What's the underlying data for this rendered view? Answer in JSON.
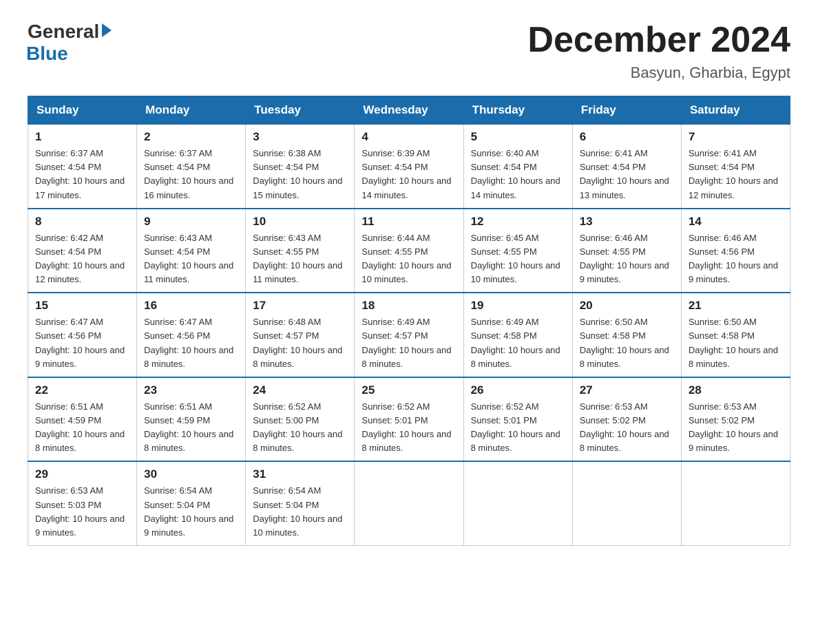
{
  "header": {
    "logo_general": "General",
    "logo_blue": "Blue",
    "month_title": "December 2024",
    "location": "Basyun, Gharbia, Egypt"
  },
  "days_of_week": [
    "Sunday",
    "Monday",
    "Tuesday",
    "Wednesday",
    "Thursday",
    "Friday",
    "Saturday"
  ],
  "weeks": [
    [
      {
        "day": "1",
        "sunrise": "6:37 AM",
        "sunset": "4:54 PM",
        "daylight": "10 hours and 17 minutes."
      },
      {
        "day": "2",
        "sunrise": "6:37 AM",
        "sunset": "4:54 PM",
        "daylight": "10 hours and 16 minutes."
      },
      {
        "day": "3",
        "sunrise": "6:38 AM",
        "sunset": "4:54 PM",
        "daylight": "10 hours and 15 minutes."
      },
      {
        "day": "4",
        "sunrise": "6:39 AM",
        "sunset": "4:54 PM",
        "daylight": "10 hours and 14 minutes."
      },
      {
        "day": "5",
        "sunrise": "6:40 AM",
        "sunset": "4:54 PM",
        "daylight": "10 hours and 14 minutes."
      },
      {
        "day": "6",
        "sunrise": "6:41 AM",
        "sunset": "4:54 PM",
        "daylight": "10 hours and 13 minutes."
      },
      {
        "day": "7",
        "sunrise": "6:41 AM",
        "sunset": "4:54 PM",
        "daylight": "10 hours and 12 minutes."
      }
    ],
    [
      {
        "day": "8",
        "sunrise": "6:42 AM",
        "sunset": "4:54 PM",
        "daylight": "10 hours and 12 minutes."
      },
      {
        "day": "9",
        "sunrise": "6:43 AM",
        "sunset": "4:54 PM",
        "daylight": "10 hours and 11 minutes."
      },
      {
        "day": "10",
        "sunrise": "6:43 AM",
        "sunset": "4:55 PM",
        "daylight": "10 hours and 11 minutes."
      },
      {
        "day": "11",
        "sunrise": "6:44 AM",
        "sunset": "4:55 PM",
        "daylight": "10 hours and 10 minutes."
      },
      {
        "day": "12",
        "sunrise": "6:45 AM",
        "sunset": "4:55 PM",
        "daylight": "10 hours and 10 minutes."
      },
      {
        "day": "13",
        "sunrise": "6:46 AM",
        "sunset": "4:55 PM",
        "daylight": "10 hours and 9 minutes."
      },
      {
        "day": "14",
        "sunrise": "6:46 AM",
        "sunset": "4:56 PM",
        "daylight": "10 hours and 9 minutes."
      }
    ],
    [
      {
        "day": "15",
        "sunrise": "6:47 AM",
        "sunset": "4:56 PM",
        "daylight": "10 hours and 9 minutes."
      },
      {
        "day": "16",
        "sunrise": "6:47 AM",
        "sunset": "4:56 PM",
        "daylight": "10 hours and 8 minutes."
      },
      {
        "day": "17",
        "sunrise": "6:48 AM",
        "sunset": "4:57 PM",
        "daylight": "10 hours and 8 minutes."
      },
      {
        "day": "18",
        "sunrise": "6:49 AM",
        "sunset": "4:57 PM",
        "daylight": "10 hours and 8 minutes."
      },
      {
        "day": "19",
        "sunrise": "6:49 AM",
        "sunset": "4:58 PM",
        "daylight": "10 hours and 8 minutes."
      },
      {
        "day": "20",
        "sunrise": "6:50 AM",
        "sunset": "4:58 PM",
        "daylight": "10 hours and 8 minutes."
      },
      {
        "day": "21",
        "sunrise": "6:50 AM",
        "sunset": "4:58 PM",
        "daylight": "10 hours and 8 minutes."
      }
    ],
    [
      {
        "day": "22",
        "sunrise": "6:51 AM",
        "sunset": "4:59 PM",
        "daylight": "10 hours and 8 minutes."
      },
      {
        "day": "23",
        "sunrise": "6:51 AM",
        "sunset": "4:59 PM",
        "daylight": "10 hours and 8 minutes."
      },
      {
        "day": "24",
        "sunrise": "6:52 AM",
        "sunset": "5:00 PM",
        "daylight": "10 hours and 8 minutes."
      },
      {
        "day": "25",
        "sunrise": "6:52 AM",
        "sunset": "5:01 PM",
        "daylight": "10 hours and 8 minutes."
      },
      {
        "day": "26",
        "sunrise": "6:52 AM",
        "sunset": "5:01 PM",
        "daylight": "10 hours and 8 minutes."
      },
      {
        "day": "27",
        "sunrise": "6:53 AM",
        "sunset": "5:02 PM",
        "daylight": "10 hours and 8 minutes."
      },
      {
        "day": "28",
        "sunrise": "6:53 AM",
        "sunset": "5:02 PM",
        "daylight": "10 hours and 9 minutes."
      }
    ],
    [
      {
        "day": "29",
        "sunrise": "6:53 AM",
        "sunset": "5:03 PM",
        "daylight": "10 hours and 9 minutes."
      },
      {
        "day": "30",
        "sunrise": "6:54 AM",
        "sunset": "5:04 PM",
        "daylight": "10 hours and 9 minutes."
      },
      {
        "day": "31",
        "sunrise": "6:54 AM",
        "sunset": "5:04 PM",
        "daylight": "10 hours and 10 minutes."
      },
      null,
      null,
      null,
      null
    ]
  ]
}
